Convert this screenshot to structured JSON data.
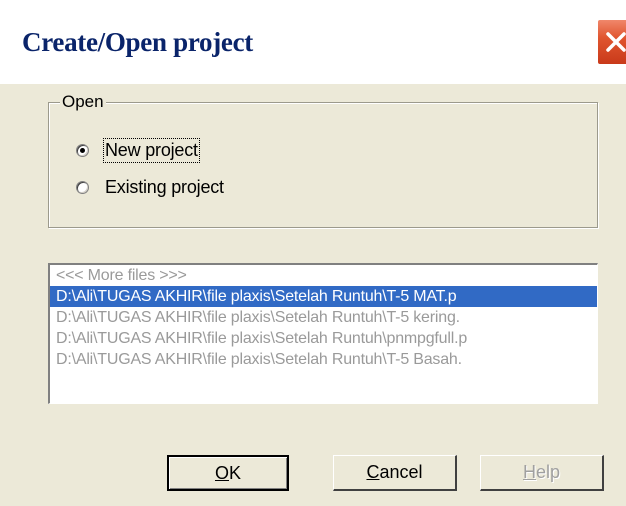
{
  "window": {
    "title": "Create/Open project",
    "close_icon": "close-x-icon"
  },
  "open_group": {
    "legend": "Open",
    "options": [
      {
        "label": "New project",
        "checked": true
      },
      {
        "label": "Existing project",
        "checked": false
      }
    ]
  },
  "recent_files": {
    "items": [
      {
        "text": "<<< More files >>>",
        "selected": false
      },
      {
        "text": "D:\\Ali\\TUGAS AKHIR\\file plaxis\\Setelah Runtuh\\T-5 MAT.p",
        "selected": true
      },
      {
        "text": "D:\\Ali\\TUGAS AKHIR\\file plaxis\\Setelah Runtuh\\T-5 kering.",
        "selected": false
      },
      {
        "text": "D:\\Ali\\TUGAS AKHIR\\file plaxis\\Setelah Runtuh\\pnmpgfull.p",
        "selected": false
      },
      {
        "text": "D:\\Ali\\TUGAS AKHIR\\file plaxis\\Setelah Runtuh\\T-5 Basah.",
        "selected": false
      }
    ]
  },
  "buttons": {
    "ok": {
      "mnemonic": "O",
      "rest": "K"
    },
    "cancel": {
      "mnemonic": "C",
      "rest": "ancel"
    },
    "help": {
      "mnemonic": "H",
      "rest": "elp",
      "enabled": false
    }
  },
  "colors": {
    "title_text": "#0a246a",
    "selection": "#316ac5",
    "close_button": "#e0552f"
  }
}
